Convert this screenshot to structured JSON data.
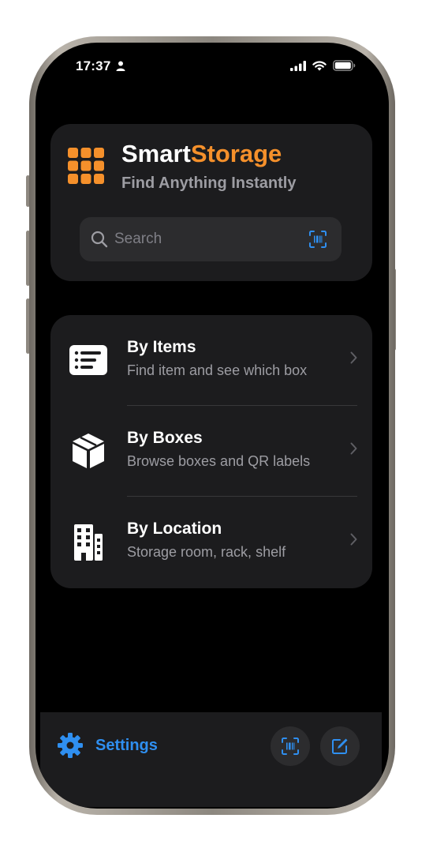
{
  "status_bar": {
    "time": "17:37",
    "icons": [
      "person-icon",
      "cellular-signal-icon",
      "wifi-icon",
      "battery-icon"
    ]
  },
  "header": {
    "title_part1": "Smart",
    "title_part2": "Storage",
    "tagline": "Find Anything Instantly",
    "logo_icon": "grid-icon"
  },
  "search": {
    "placeholder": "Search",
    "value": "",
    "scan_icon": "barcode-scan-icon"
  },
  "menu": {
    "items": [
      {
        "title": "By Items",
        "subtitle": "Find item and see which box",
        "icon": "list-icon"
      },
      {
        "title": "By Boxes",
        "subtitle": "Browse boxes and QR labels",
        "icon": "box-icon"
      },
      {
        "title": "By Location",
        "subtitle": "Storage room, rack, shelf",
        "icon": "building-icon"
      }
    ]
  },
  "toolbar": {
    "settings_label": "Settings",
    "settings_icon": "gear-icon",
    "scan_icon": "barcode-scan-icon",
    "compose_icon": "compose-icon"
  },
  "colors": {
    "accent_orange": "#f5902b",
    "accent_blue": "#2f8ff0",
    "card_bg": "#1c1c1e",
    "screen_bg": "#000000"
  }
}
